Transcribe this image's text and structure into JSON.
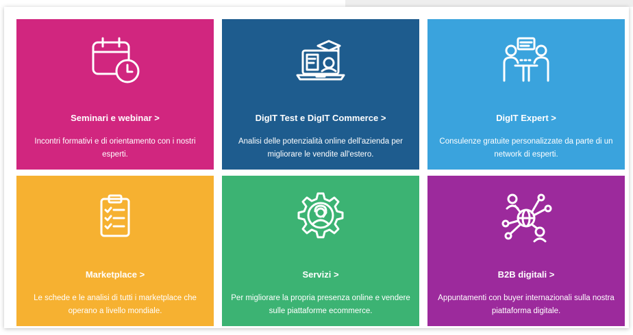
{
  "colors": {
    "magenta": "#d1267f",
    "navy": "#1e5c8e",
    "sky": "#3aa3dd",
    "amber": "#f6b131",
    "green": "#3cb373",
    "purple": "#9c2a9c"
  },
  "tiles": [
    {
      "title": "Seminari e webinar >",
      "desc": "Incontri formativi e di orientamento con i nostri esperti.",
      "icon": "calendar-clock-icon",
      "color": "#d1267f"
    },
    {
      "title": "DigIT Test e DigIT Commerce >",
      "desc": "Analisi delle potenzialità online dell'azienda per migliorare le vendite all'estero.",
      "icon": "laptop-graduation-icon",
      "color": "#1e5c8e"
    },
    {
      "title": "DigIT Expert >",
      "desc": "Consulenze gratuite personalizzate da parte di un network di esperti.",
      "icon": "meeting-table-icon",
      "color": "#3aa3dd"
    },
    {
      "title": "Marketplace >",
      "desc": "Le schede e le analisi di tutti i marketplace che operano a livello mondiale.",
      "icon": "clipboard-checklist-icon",
      "color": "#f6b131"
    },
    {
      "title": "Servizi >",
      "desc": "Per migliorare la propria presenza online e vendere sulle piattaforme ecommerce.",
      "icon": "gear-operator-icon",
      "color": "#3cb373"
    },
    {
      "title": "B2B digitali >",
      "desc": "Appuntamenti con buyer internazionali sulla nostra piattaforma digitale.",
      "icon": "global-network-icon",
      "color": "#9c2a9c"
    }
  ]
}
